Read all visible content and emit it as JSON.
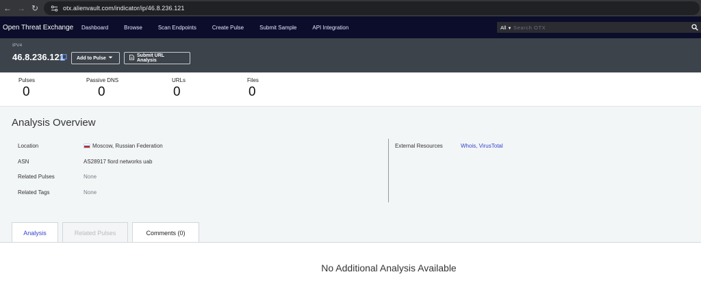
{
  "browser": {
    "url": "otx.alienvault.com/indicator/ip/46.8.236.121"
  },
  "nav": {
    "brand": "Open Threat Exchange",
    "links": [
      "Dashboard",
      "Browse",
      "Scan Endpoints",
      "Create Pulse",
      "Submit Sample",
      "API Integration"
    ],
    "search_scope": "All",
    "search_placeholder": "Search OTX"
  },
  "indicator": {
    "type": "IPV4",
    "value": "46.8.236.121",
    "add_to_pulse_label": "Add to Pulse",
    "submit_url_label": "Submit URL Analysis"
  },
  "stats": [
    {
      "label": "Pulses",
      "value": "0"
    },
    {
      "label": "Passive DNS",
      "value": "0"
    },
    {
      "label": "URLs",
      "value": "0"
    },
    {
      "label": "Files",
      "value": "0"
    }
  ],
  "overview": {
    "title": "Analysis Overview",
    "location_label": "Location",
    "location_value": "Moscow, Russian Federation",
    "location_flag_colors": [
      "#ffffff",
      "#2b4bd6",
      "#d52b1e"
    ],
    "asn_label": "ASN",
    "asn_value": "AS28917 fiord networks uab",
    "related_pulses_label": "Related Pulses",
    "related_pulses_value": "None",
    "related_tags_label": "Related Tags",
    "related_tags_value": "None",
    "external_label": "External Resources",
    "external_value": "Whois, VirusTotal"
  },
  "tabs": [
    {
      "label": "Analysis",
      "state": "active"
    },
    {
      "label": "Related Pulses",
      "state": "disabled"
    },
    {
      "label": "Comments (0)",
      "state": "normal"
    }
  ],
  "content": {
    "message": "No Additional Analysis Available"
  },
  "colors": {
    "nav_bg": "#0b0d2a",
    "header_bg": "#3d434b",
    "accent": "#3344cc",
    "overview_bg": "#f3f6f7"
  },
  "icons": [
    "back-icon",
    "forward-icon",
    "reload-icon",
    "site-info-icon",
    "search-icon",
    "copy-icon",
    "chevron-down-icon",
    "document-icon"
  ]
}
